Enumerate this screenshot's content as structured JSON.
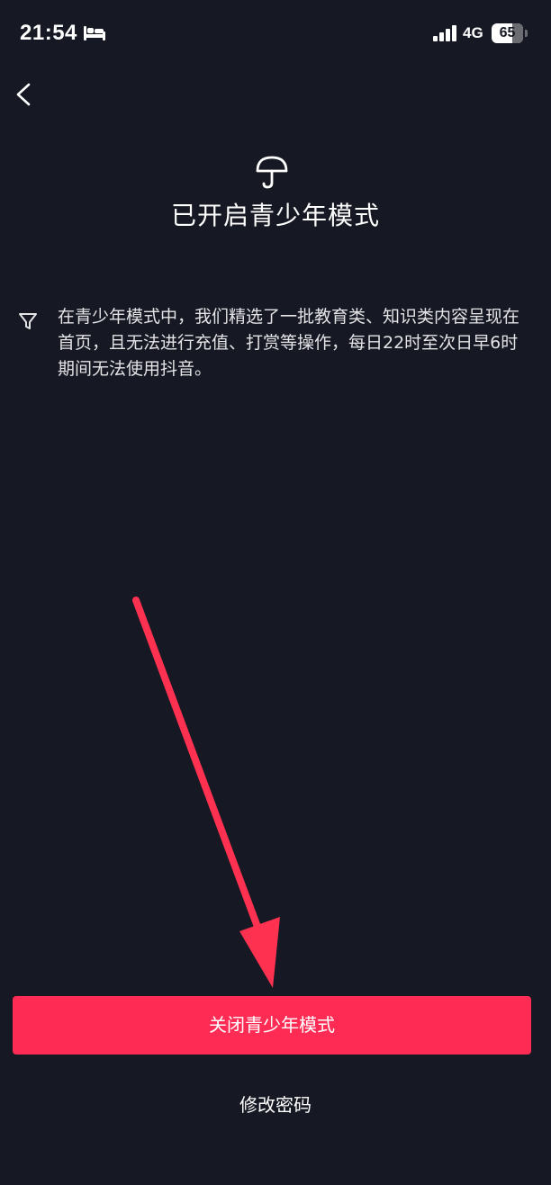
{
  "status_bar": {
    "time": "21:54",
    "sleep_icon": "bed-icon",
    "signal_icon": "cellular-signal-icon",
    "network": "4G",
    "battery_level": "65",
    "battery_fraction": 0.65
  },
  "nav": {
    "back_icon": "chevron-left-icon"
  },
  "header": {
    "icon": "umbrella-icon",
    "title": "已开启青少年模式"
  },
  "notice": {
    "icon": "filter-icon",
    "text": "在青少年模式中，我们精选了一批教育类、知识类内容呈现在首页，且无法进行充值、打赏等操作，每日22时至次日早6时期间无法使用抖音。"
  },
  "annotation": {
    "icon": "red-arrow-icon",
    "color": "#fe3150"
  },
  "actions": {
    "close_mode_label": "关闭青少年模式",
    "change_password_label": "修改密码"
  },
  "colors": {
    "background": "#161823",
    "primary": "#fe2c55",
    "text": "#ffffff"
  }
}
